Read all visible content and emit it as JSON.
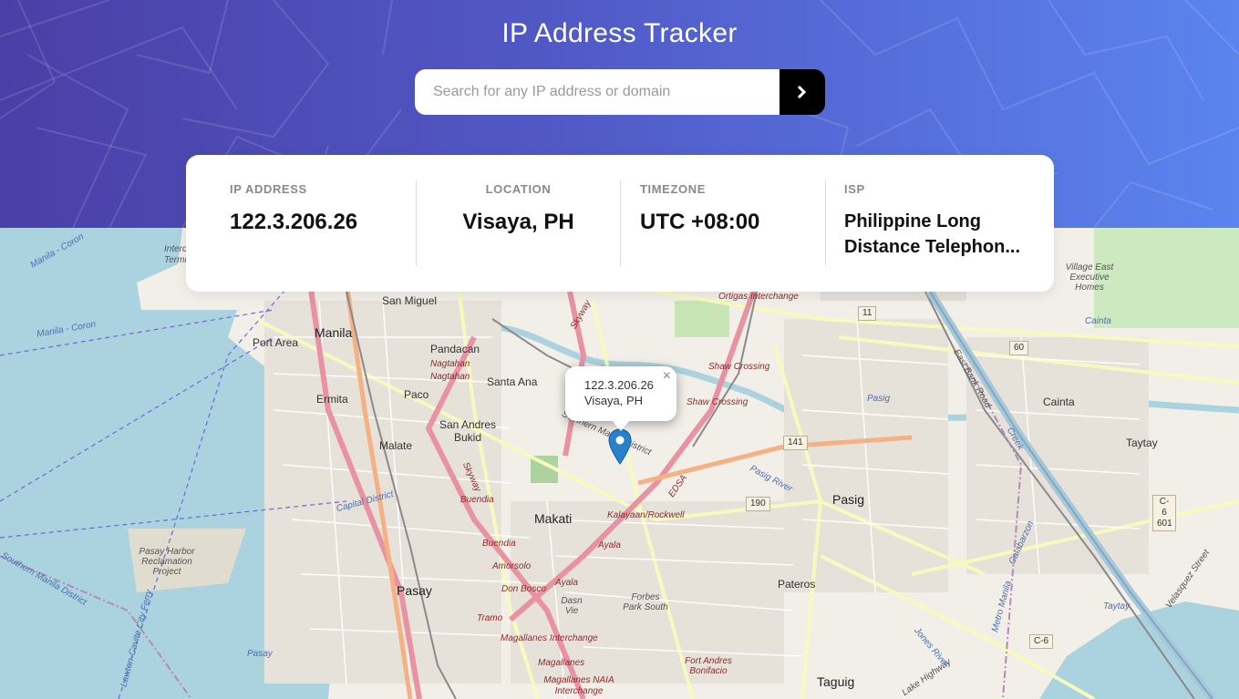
{
  "header": {
    "title": "IP Address Tracker",
    "search_placeholder": "Search for any IP address or domain",
    "search_value": "",
    "submit_icon": "chevron-right-icon"
  },
  "info": {
    "ip_label": "IP ADDRESS",
    "ip_value": "122.3.206.26",
    "location_label": "LOCATION",
    "location_value": "Visaya, PH",
    "timezone_label": "TIMEZONE",
    "timezone_value": "UTC +08:00",
    "isp_label": "ISP",
    "isp_line1": "Philippine Long",
    "isp_line2": "Distance Telephon..."
  },
  "popup": {
    "ip": "122.3.206.26",
    "location": "Visaya, PH",
    "close": "×"
  },
  "map": {
    "places": [
      "Manila",
      "Port Area",
      "San Miguel",
      "Pandacan",
      "Santa Ana",
      "Paco",
      "Ermita",
      "Malate",
      "San Andres Bukid",
      "Makati",
      "Pasay",
      "Pateros",
      "Pasig",
      "Cainta",
      "Taytay",
      "Taguig",
      "Fort Andres Bonifacio",
      "Forbes Park South",
      "Dasn Vie",
      "Pasay Harbor Reclamation Project",
      "Village East Executive Homes",
      "Intercontinental Terminal"
    ],
    "roads": [
      "Ortigas Interchange",
      "Shaw Crossing",
      "Kalayaan/Rockwell",
      "Ayala",
      "Buendia",
      "Amorsolo",
      "Don Bosco",
      "Tramo",
      "Magallanes Interchange",
      "Magallanes",
      "Magallanes NAIA Interchange",
      "Southern Manila District",
      "Skyway",
      "EDSA",
      "Nagtahan",
      "Capital District",
      "East Bank Road",
      "Metro Manila",
      "Calabarzon",
      "Velasquez Street",
      "Lake Highway",
      "Jones River"
    ],
    "water": [
      "Manila - Coron",
      "Pasig",
      "Pasig River",
      "Pasay",
      "Cainta",
      "Taytay",
      "Creek",
      "Lawton-Cavite City Ferry",
      "Southern Manila District"
    ],
    "shields": [
      "11",
      "60",
      "141",
      "190",
      "C-6 601",
      "C-6"
    ],
    "colors": {
      "water": "#aad3df",
      "land": "#f2efe9",
      "road_major": "#e892a2",
      "road_secondary": "#f7fabf",
      "marker": "#2a81cb"
    }
  }
}
